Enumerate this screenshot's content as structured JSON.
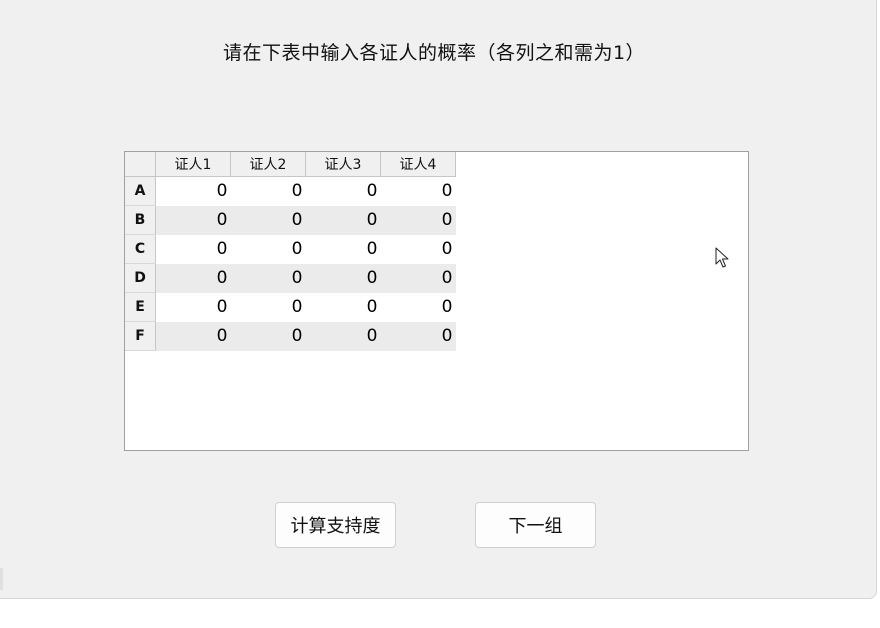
{
  "instruction": "请在下表中输入各证人的概率（各列之和需为1）",
  "table": {
    "columns": [
      "证人1",
      "证人2",
      "证人3",
      "证人4"
    ],
    "rows": [
      {
        "label": "A",
        "values": [
          "0",
          "0",
          "0",
          "0"
        ]
      },
      {
        "label": "B",
        "values": [
          "0",
          "0",
          "0",
          "0"
        ]
      },
      {
        "label": "C",
        "values": [
          "0",
          "0",
          "0",
          "0"
        ]
      },
      {
        "label": "D",
        "values": [
          "0",
          "0",
          "0",
          "0"
        ]
      },
      {
        "label": "E",
        "values": [
          "0",
          "0",
          "0",
          "0"
        ]
      },
      {
        "label": "F",
        "values": [
          "0",
          "0",
          "0",
          "0"
        ]
      }
    ]
  },
  "buttons": {
    "calculate": "计算支持度",
    "next_group": "下一组"
  },
  "colors": {
    "window_bg": "#f0f0f0",
    "alt_row": "#ebebeb",
    "grid_line": "#c6c6c6"
  },
  "icons": {
    "cursor": "mouse-pointer-icon"
  }
}
